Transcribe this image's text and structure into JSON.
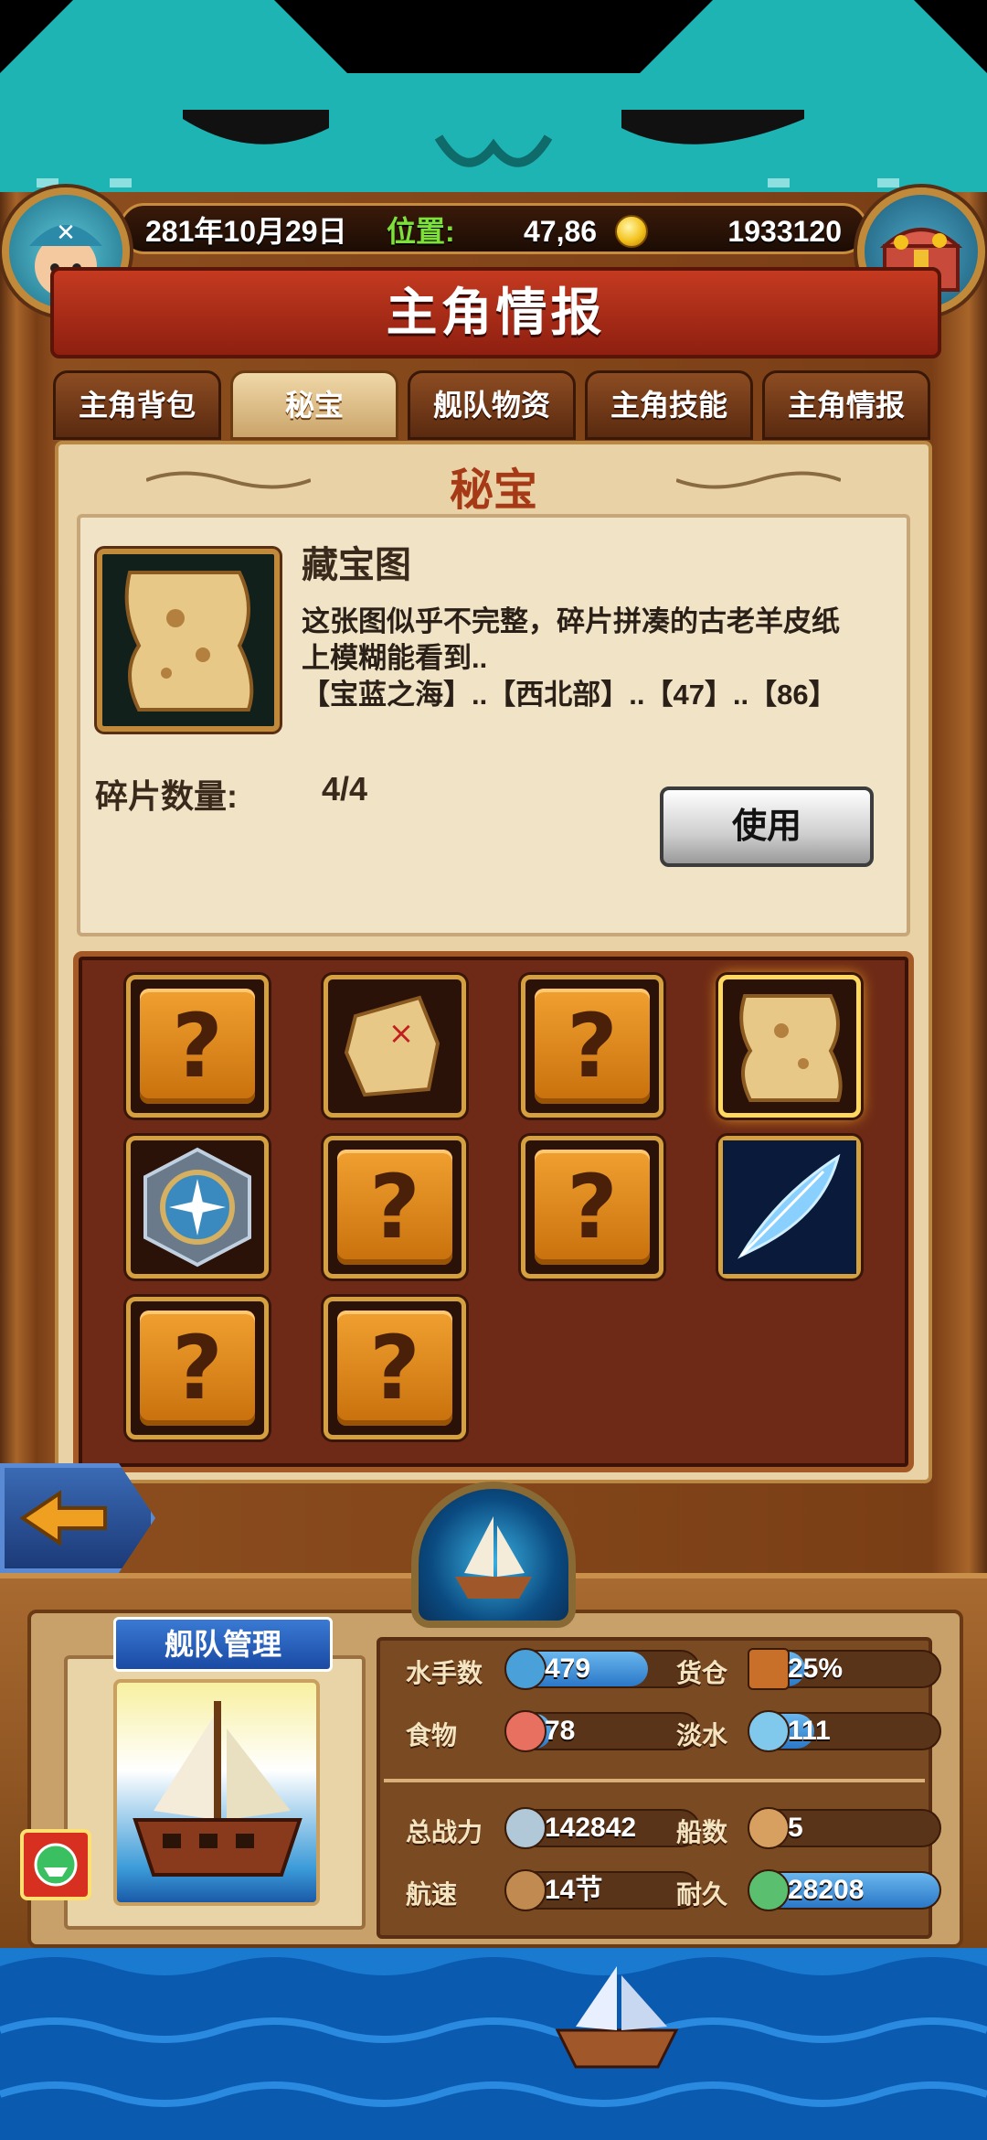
{
  "status": {
    "date": "281年10月29日",
    "position_label": "位置:",
    "position_value": "47,86",
    "gold": "1933120"
  },
  "title": "主角情报",
  "tabs": [
    {
      "label": "主角背包",
      "active": false
    },
    {
      "label": "秘宝",
      "active": true
    },
    {
      "label": "舰队物资",
      "active": false
    },
    {
      "label": "主角技能",
      "active": false
    },
    {
      "label": "主角情报",
      "active": false
    }
  ],
  "section_title": "秘宝",
  "item": {
    "name": "藏宝图",
    "description_line1": "这张图似乎不完整，碎片拼凑的古老羊皮纸",
    "description_line2": "上模糊能看到..",
    "description_line3": "【宝蓝之海】..【西北部】..【47】..【86】",
    "fragment_label": "碎片数量:",
    "fragment_value": "4/4",
    "use_button": "使用"
  },
  "grid": [
    {
      "type": "unknown",
      "icon": "question-icon",
      "symbol": "?"
    },
    {
      "type": "item",
      "icon": "torn-map-icon"
    },
    {
      "type": "unknown",
      "icon": "question-icon",
      "symbol": "?"
    },
    {
      "type": "item",
      "icon": "treasure-map-icon",
      "selected": true
    },
    {
      "type": "item",
      "icon": "compass-shield-icon"
    },
    {
      "type": "unknown",
      "icon": "question-icon",
      "symbol": "?"
    },
    {
      "type": "unknown",
      "icon": "question-icon",
      "symbol": "?"
    },
    {
      "type": "item",
      "icon": "blue-feather-icon"
    },
    {
      "type": "unknown",
      "icon": "question-icon",
      "symbol": "?"
    },
    {
      "type": "unknown",
      "icon": "question-icon",
      "symbol": "?"
    }
  ],
  "fleet": {
    "label": "舰队管理",
    "stats": [
      {
        "label": "水手数",
        "value": "479",
        "icon": "sailor-icon",
        "fill": 0.72
      },
      {
        "label": "货仓",
        "value": "25%",
        "icon": "crate-icon",
        "fill": 0.25
      },
      {
        "label": "食物",
        "value": "78",
        "icon": "meat-icon",
        "fill": 0.18
      },
      {
        "label": "淡水",
        "value": "111",
        "icon": "water-jug-icon",
        "fill": 0.3
      },
      {
        "label": "总战力",
        "value": "142842",
        "icon": "swords-icon",
        "fill": 0
      },
      {
        "label": "船数",
        "value": "5",
        "icon": "ship-icon",
        "fill": 0
      },
      {
        "label": "航速",
        "value": "14节",
        "icon": "sail-icon",
        "fill": 0
      },
      {
        "label": "耐久",
        "value": "28208",
        "icon": "durability-ship-icon",
        "fill": 1.0
      }
    ]
  },
  "colors": {
    "accent_red": "#a63a16",
    "tab_active": "#caa46a",
    "position_green": "#7ee03a",
    "bar_blue": "#2a78c8"
  }
}
